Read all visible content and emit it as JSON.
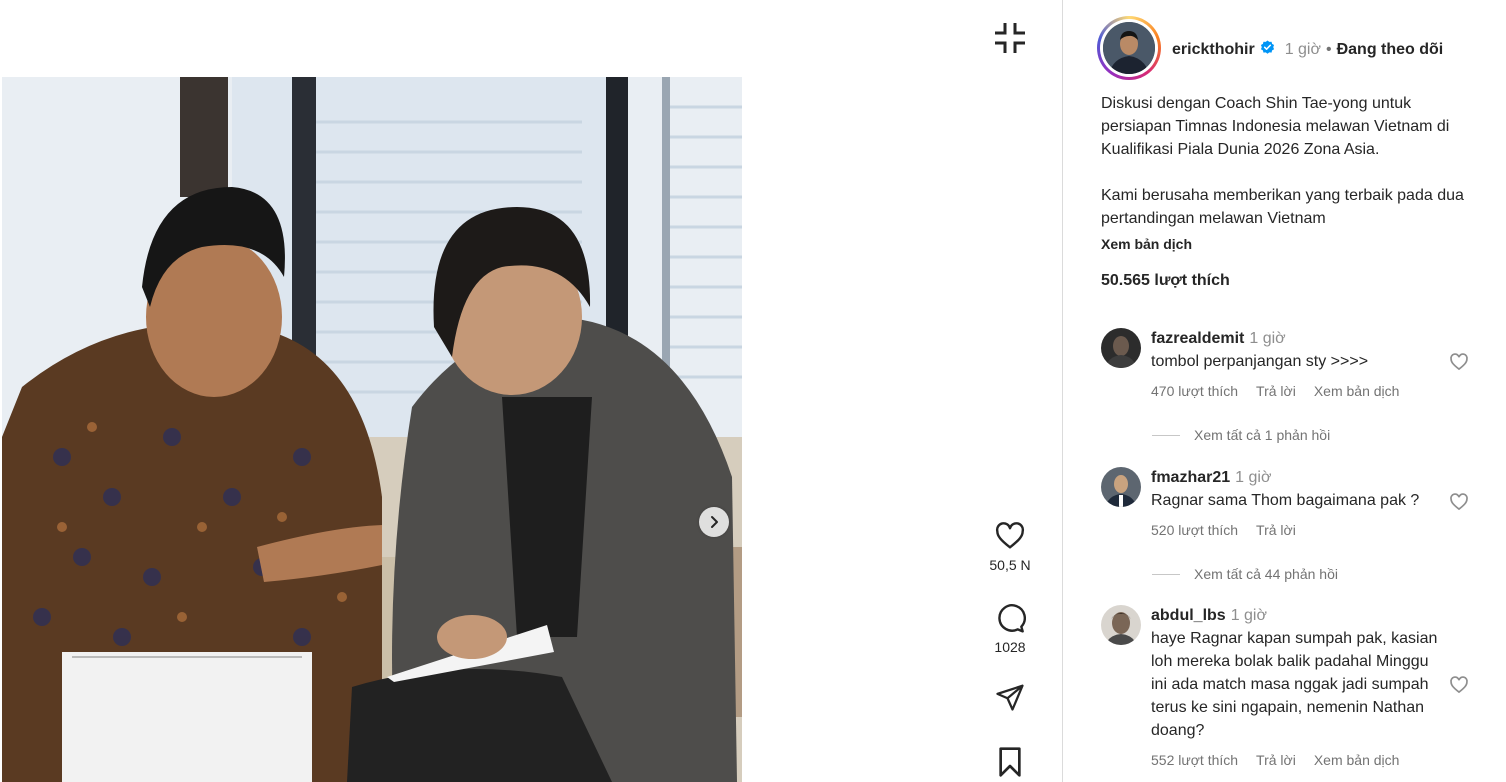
{
  "post": {
    "username": "erickthohir",
    "time": "1 giờ",
    "separator": "•",
    "follow_status": "Đang theo dõi",
    "caption_p1": "Diskusi dengan Coach Shin Tae-yong untuk persiapan Timnas Indonesia melawan Vietnam di Kualifikasi Piala Dunia 2026 Zona Asia.",
    "caption_p2": "Kami berusaha memberikan yang terbaik pada dua pertandingan melawan Vietnam",
    "see_translation": "Xem bản dịch",
    "likes_total": "50.565 lượt thích"
  },
  "actions": {
    "like_count": "50,5 N",
    "comment_count": "1028"
  },
  "comments": [
    {
      "username": "fazrealdemit",
      "time": "1 giờ",
      "text": "tombol perpanjangan sty >>>>",
      "likes": "470 lượt thích",
      "reply": "Trả lời",
      "translate": "Xem bản dịch",
      "view_replies": "Xem tất cả 1 phản hồi"
    },
    {
      "username": "fmazhar21",
      "time": "1 giờ",
      "text": "Ragnar sama Thom bagaimana pak ?",
      "likes": "520 lượt thích",
      "reply": "Trả lời",
      "view_replies": "Xem tất cả 44 phản hồi"
    },
    {
      "username": "abdul_lbs",
      "time": "1 giờ",
      "text": "haye Ragnar kapan sumpah pak, kasian loh mereka bolak balik padahal Minggu ini ada match masa nggak jadi sumpah terus ke sini ngapain, nemenin Nathan doang?",
      "likes": "552 lượt thích",
      "reply": "Trả lời",
      "translate": "Xem bản dịch"
    }
  ],
  "colors": {
    "text": "#262626",
    "secondary": "#8e8e8e",
    "verified": "#0095f6",
    "divider": "#dbdbdb"
  },
  "icons": [
    "collapse-icon",
    "chevron-right-icon",
    "heart-icon",
    "comment-icon",
    "share-icon",
    "bookmark-icon",
    "verified-badge-icon"
  ]
}
